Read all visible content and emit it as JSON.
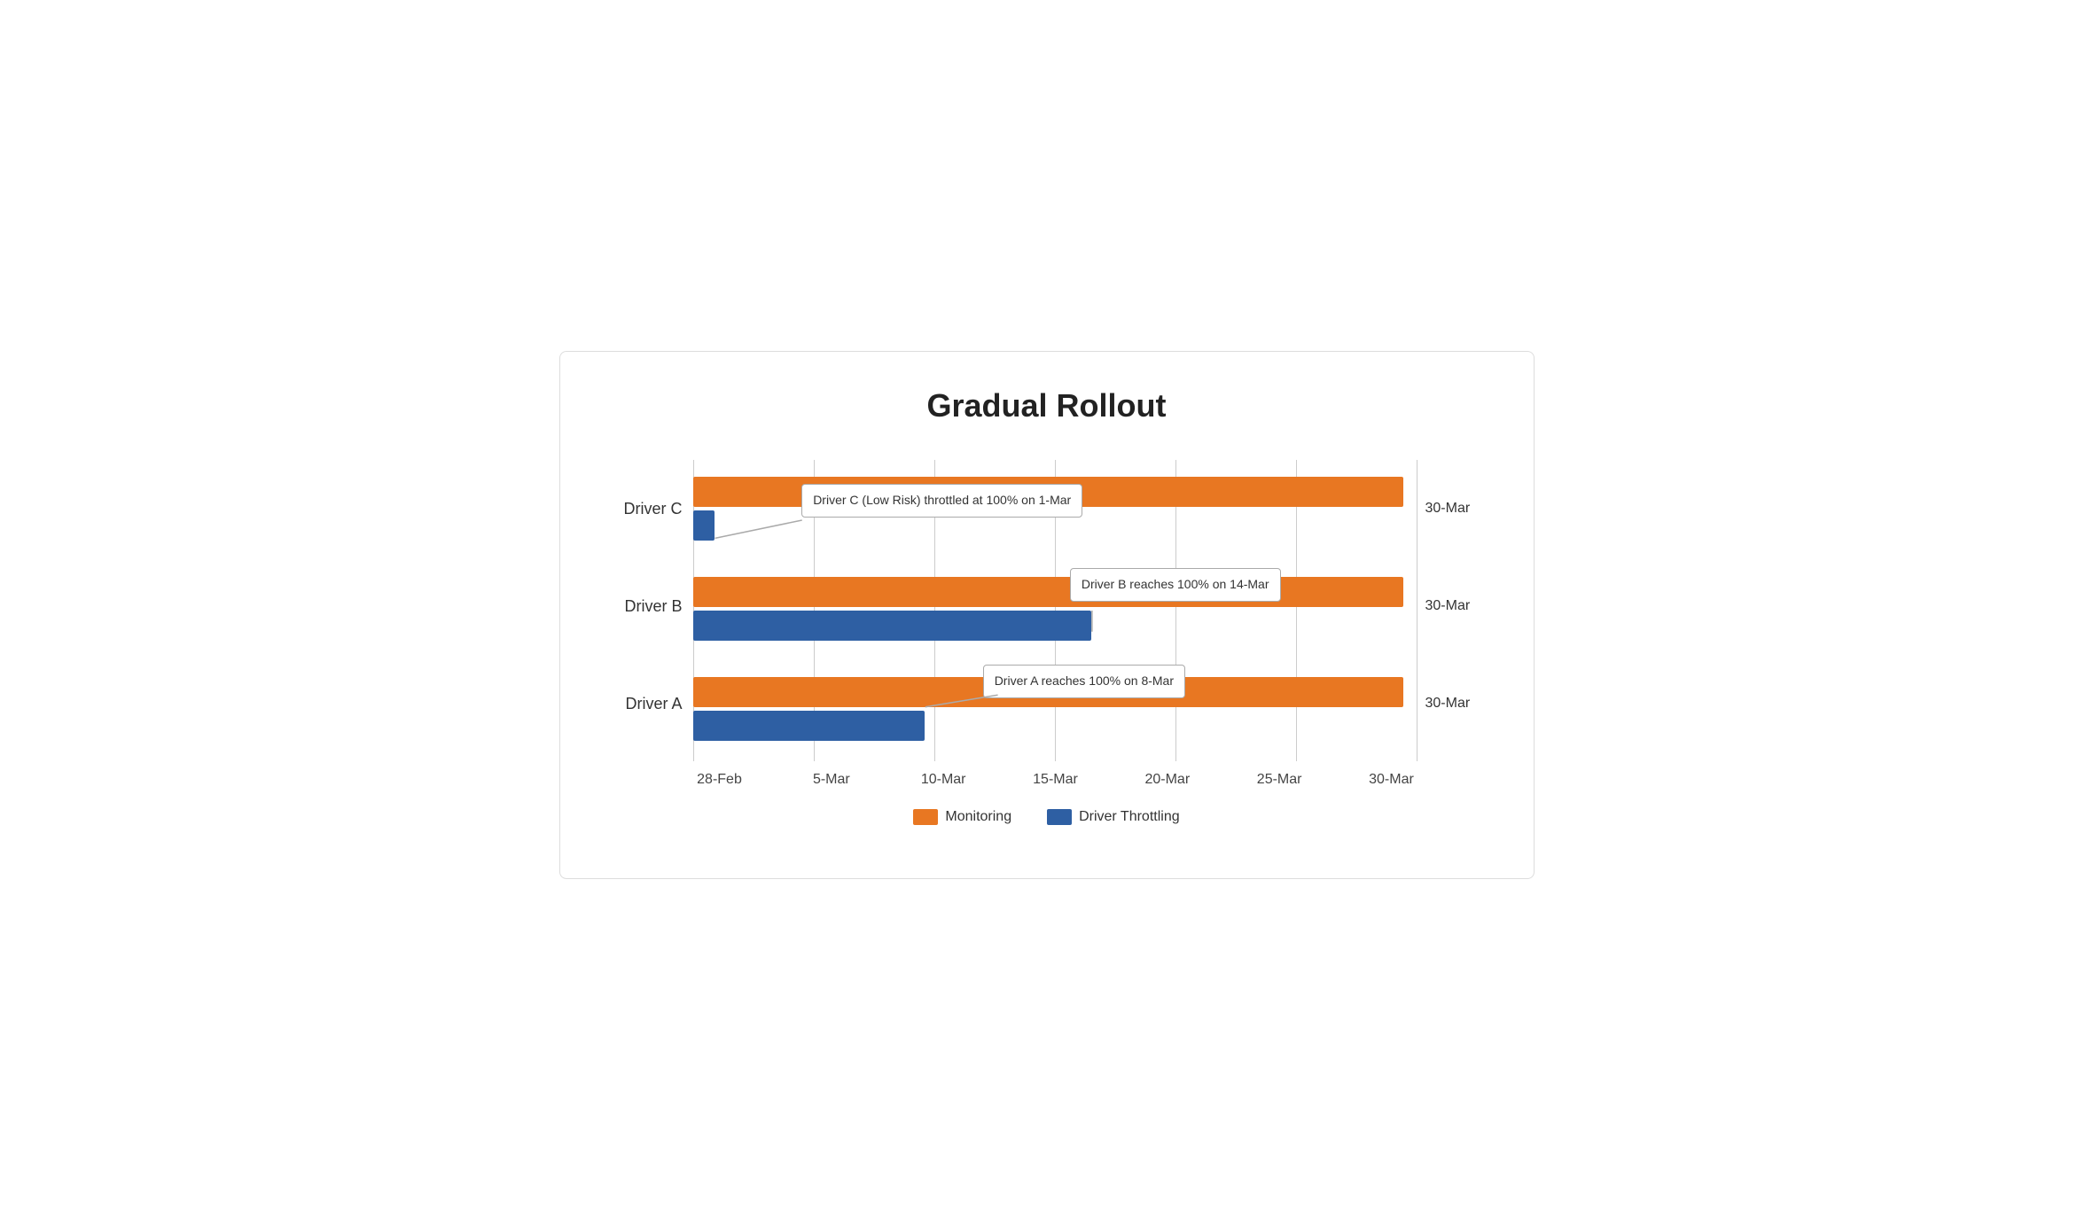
{
  "chart": {
    "title": "Gradual Rollout",
    "y_labels": [
      "Driver C",
      "Driver B",
      "Driver A"
    ],
    "right_labels": [
      "30-Mar",
      "30-Mar",
      "30-Mar"
    ],
    "x_labels": [
      "28-Feb",
      "5-Mar",
      "10-Mar",
      "15-Mar",
      "20-Mar",
      "25-Mar",
      "30-Mar"
    ],
    "legend": {
      "monitoring_label": "Monitoring",
      "throttling_label": "Driver Throttling",
      "monitoring_color": "#E87722",
      "throttling_color": "#2E5FA3"
    },
    "annotations": [
      {
        "id": "anno-c",
        "text": "Driver C (Low Risk) throttled at\n100% on 1-Mar"
      },
      {
        "id": "anno-b",
        "text": "Driver B reaches 100% on\n14-Mar"
      },
      {
        "id": "anno-a",
        "text": "Driver A reaches 100% on 8-Mar"
      }
    ],
    "bars": {
      "driver_c": {
        "monitoring_width_pct": 98,
        "throttling_width_pct": 3
      },
      "driver_b": {
        "monitoring_width_pct": 98,
        "throttling_width_pct": 55
      },
      "driver_a": {
        "monitoring_width_pct": 98,
        "throttling_width_pct": 32
      }
    }
  }
}
